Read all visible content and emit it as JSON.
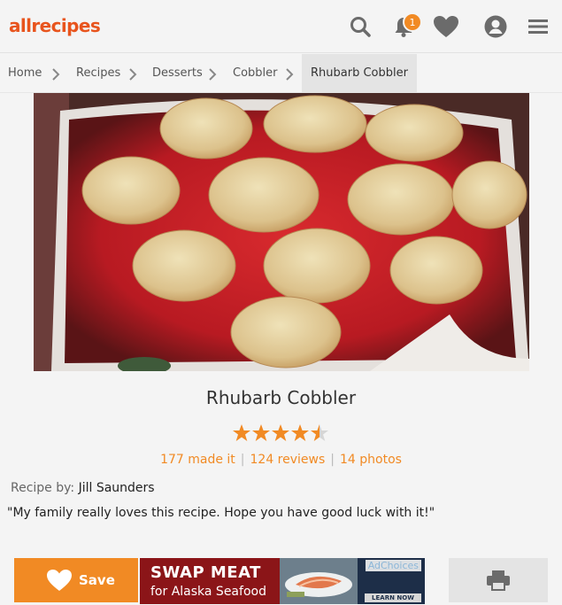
{
  "header": {
    "logo_text": "allrecipes",
    "notification_count": "1",
    "icons": [
      "search-icon",
      "bell-icon",
      "heart-icon",
      "profile-icon",
      "menu-icon"
    ],
    "accent_color": "#e8541d",
    "badge_color": "#f18a24"
  },
  "breadcrumb": {
    "items": [
      "Home",
      "Recipes",
      "Desserts",
      "Cobbler",
      "Rhubarb Cobbler"
    ]
  },
  "recipe": {
    "title": "Rhubarb Cobbler",
    "rating": 4.5,
    "rating_max": 5,
    "made_it": "177 made it",
    "reviews": "124 reviews",
    "photos": "14 photos",
    "byline_label": "Recipe by:",
    "author": "Jill Saunders",
    "description": "\"My family really loves this recipe. Hope you have good luck with it!\""
  },
  "actions": {
    "save_label": "Save"
  },
  "ad": {
    "headline": "SWAP MEAT",
    "subline": "for Alaska Seafood",
    "adchoices": "AdChoices",
    "cta": "LEARN NOW"
  }
}
